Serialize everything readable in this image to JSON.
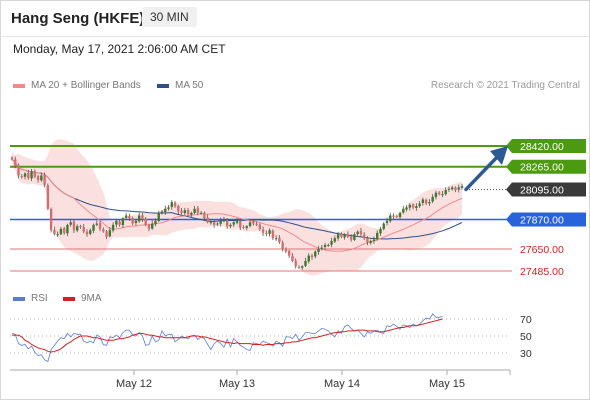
{
  "header": {
    "title": "Hang Seng (HKFE)",
    "timeframe": "30 MIN",
    "datetime": "Monday, May 17, 2021 2:06:00 AM CET"
  },
  "legend": {
    "main": [
      {
        "label": "MA 20 + Bollinger Bands",
        "color": "#f08a8a"
      },
      {
        "label": "MA 50",
        "color": "#2c4f8a"
      }
    ],
    "rsi": [
      {
        "label": "RSI",
        "color": "#5b7bd6"
      },
      {
        "label": "9MA",
        "color": "#d42020"
      }
    ],
    "credit": "Research © 2021 Trading Central"
  },
  "colors": {
    "candle_up": "#3d7a30",
    "candle_down": "#d46d6d",
    "resistance": "#4c9a12",
    "pivot": "#2962d9",
    "support": "#e07575",
    "band_fill": "#fbe0e0",
    "arrow": "#2c5b94",
    "current_bg": "#3a3a3a"
  },
  "chart_data": [
    {
      "type": "candlestick",
      "title": "Hang Seng (HKFE)",
      "xlabel": "",
      "ylabel": "",
      "x_ticks": [
        "May 12",
        "May 13",
        "May 14",
        "May 15"
      ],
      "ylim": [
        27430,
        28470
      ],
      "current_price": 28095.0,
      "levels": [
        {
          "label": "28420.00",
          "value": 28420,
          "kind": "resistance"
        },
        {
          "label": "28265.00",
          "value": 28265,
          "kind": "resistance"
        },
        {
          "label": "28095.00",
          "value": 28095,
          "kind": "current"
        },
        {
          "label": "27870.00",
          "value": 27870,
          "kind": "pivot"
        },
        {
          "label": "27650.00",
          "value": 27650,
          "kind": "support"
        },
        {
          "label": "27485.00",
          "value": 27485,
          "kind": "support"
        }
      ],
      "closes": [
        28320,
        28270,
        28200,
        28190,
        28215,
        28180,
        28230,
        28190,
        28165,
        28200,
        28130,
        27950,
        27790,
        27760,
        27760,
        27800,
        27770,
        27830,
        27850,
        27790,
        27820,
        27820,
        27780,
        27760,
        27790,
        27830,
        27840,
        27800,
        27780,
        27740,
        27790,
        27830,
        27860,
        27830,
        27880,
        27900,
        27880,
        27840,
        27860,
        27900,
        27870,
        27830,
        27800,
        27840,
        27860,
        27920,
        27930,
        27950,
        27960,
        28000,
        27970,
        27930,
        27920,
        27940,
        27910,
        27920,
        27950,
        27920,
        27920,
        27880,
        27850,
        27850,
        27830,
        27840,
        27860,
        27870,
        27820,
        27830,
        27850,
        27860,
        27810,
        27810,
        27820,
        27850,
        27840,
        27830,
        27800,
        27770,
        27760,
        27790,
        27730,
        27730,
        27700,
        27650,
        27630,
        27600,
        27560,
        27520,
        27510,
        27520,
        27560,
        27600,
        27590,
        27630,
        27650,
        27660,
        27680,
        27680,
        27710,
        27730,
        27760,
        27740,
        27760,
        27740,
        27720,
        27760,
        27780,
        27760,
        27730,
        27700,
        27710,
        27720,
        27770,
        27800,
        27840,
        27860,
        27900,
        27890,
        27890,
        27920,
        27950,
        27960,
        27980,
        27960,
        27970,
        27990,
        28020,
        27990,
        28000,
        28040,
        28070,
        28060,
        28060,
        28090,
        28100,
        28110,
        28090,
        28110,
        28120
      ]
    },
    {
      "type": "line",
      "title": "",
      "series": [
        {
          "name": "RSI",
          "values": [
            53,
            52,
            41,
            39,
            40,
            35,
            38,
            31,
            27,
            28,
            22,
            20,
            34,
            39,
            44,
            48,
            47,
            53,
            49,
            53,
            52,
            52,
            44,
            42,
            44,
            42,
            51,
            49,
            40,
            39,
            49,
            48,
            51,
            48,
            54,
            57,
            57,
            51,
            50,
            54,
            50,
            39,
            40,
            50,
            43,
            45,
            56,
            50,
            52,
            52,
            43,
            46,
            50,
            48,
            47,
            50,
            51,
            46,
            49,
            47,
            40,
            34,
            41,
            44,
            41,
            37,
            46,
            37,
            47,
            43,
            39,
            37,
            34,
            33,
            42,
            41,
            40,
            44,
            42,
            41,
            38,
            44,
            42,
            38,
            49,
            49,
            47,
            52,
            45,
            49,
            54,
            54,
            53,
            53,
            56,
            59,
            58,
            56,
            52,
            49,
            56,
            53,
            61,
            63,
            59,
            56,
            57,
            53,
            49,
            55,
            53,
            56,
            57,
            54,
            53,
            62,
            61,
            64,
            61,
            58,
            63,
            62,
            60,
            64,
            62,
            64,
            68,
            71,
            70,
            76,
            72,
            72,
            73
          ]
        },
        {
          "name": "9MA",
          "values": [
            51,
            51,
            51,
            49,
            45,
            43,
            40,
            38,
            36,
            35,
            34,
            32,
            31,
            32,
            33,
            35,
            38,
            41,
            43,
            46,
            48,
            50,
            50,
            50,
            49,
            48,
            48,
            47,
            46,
            45,
            45,
            45,
            46,
            47,
            47,
            48,
            49,
            51,
            52,
            53,
            53,
            52,
            51,
            51,
            50,
            49,
            49,
            48,
            48,
            48,
            48,
            48,
            48,
            48,
            49,
            50,
            50,
            50,
            49,
            49,
            48,
            47,
            46,
            45,
            44,
            43,
            42,
            42,
            41,
            42,
            41,
            41,
            41,
            41,
            40,
            40,
            40,
            39,
            40,
            40,
            40,
            41,
            41,
            41,
            42,
            42,
            43,
            43,
            44,
            45,
            46,
            47,
            48,
            48,
            49,
            50,
            51,
            52,
            53,
            54,
            54,
            55,
            55,
            56,
            56,
            56,
            57,
            57,
            57,
            56,
            56,
            56,
            55,
            55,
            55,
            56,
            57,
            58,
            59,
            60,
            60,
            61,
            62,
            62,
            62,
            63,
            64,
            65,
            66,
            67,
            68,
            69,
            70
          ]
        }
      ],
      "y_ticks": [
        70,
        50,
        30
      ],
      "ylim": [
        0,
        100
      ]
    }
  ]
}
